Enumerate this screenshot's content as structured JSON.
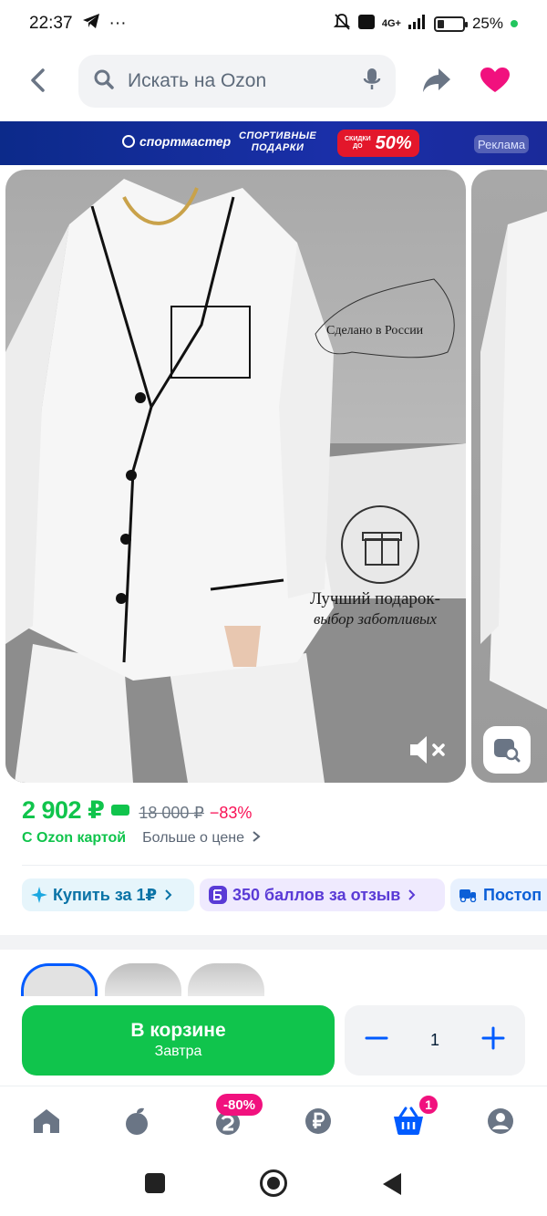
{
  "status_bar": {
    "time": "22:37",
    "dots": "···",
    "network": "4G+",
    "battery": "25%"
  },
  "header": {
    "search_placeholder": "Искать на Ozon"
  },
  "banner": {
    "brand": "спортмастер",
    "line1": "СПОРТИВНЫЕ",
    "line2": "ПОДАРКИ",
    "sale_small1": "СКИДКИ",
    "sale_small2": "ДО",
    "sale_percent": "50%",
    "ad_label": "Реклама"
  },
  "product_image": {
    "made_in": "Сделано в России",
    "gift_line1": "Лучший подарок-",
    "gift_line2": "выбор заботливых"
  },
  "price": {
    "current": "2 902 ₽",
    "old": "18 000 ₽",
    "discount": "−83%",
    "ozon_card": "С Ozon картой",
    "more_price": "Больше о цене"
  },
  "chips": [
    {
      "label": "Купить за 1₽"
    },
    {
      "label": "350 баллов за отзыв"
    },
    {
      "label": "Постоп"
    }
  ],
  "cart": {
    "button_title": "В корзине",
    "button_sub": "Завтра",
    "quantity": "1"
  },
  "bottom_nav": {
    "sale_badge": "-80%",
    "cart_count": "1"
  },
  "colors": {
    "ozon_green": "#10c44c",
    "ozon_blue": "#005bff",
    "accent_pink": "#f1117e",
    "discount_red": "#f91155"
  }
}
